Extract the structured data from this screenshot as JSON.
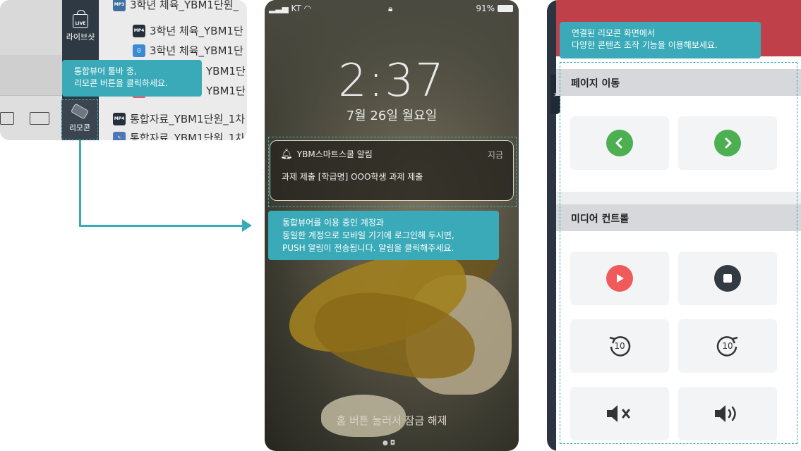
{
  "panel_viewer": {
    "live_label": "라이브샷",
    "live_badge": "LIVE",
    "remote_label": "리모콘",
    "files": [
      {
        "type": "MP3",
        "name": "3학년 체육_YBM1단원_"
      },
      {
        "type": "MP4",
        "name": "3학년 체육_YBM1단"
      },
      {
        "type": "",
        "name": "3학년 체육_YBM1단"
      },
      {
        "type": "",
        "name": "YBM1단"
      },
      {
        "type": "",
        "name": "YBM1단"
      },
      {
        "type": "MP4",
        "name": "통합자료_YBM1단원_1차"
      },
      {
        "type": "",
        "name": "통합자료_YBM1단원_1차"
      }
    ],
    "tooltip_line1": "통합뷰어 툴바 중,",
    "tooltip_line2": "리모콘 버튼을 클릭하세요."
  },
  "panel_phone": {
    "status_carrier": "KT",
    "status_battery": "91%",
    "clock": "2:37",
    "date": "7월 26일 월요일",
    "notification": {
      "app": "YBM스마트스쿨 알림",
      "time": "지금",
      "message": "과제 제출 [학급명] OOO학생 과제 제출"
    },
    "tooltip_line1": "통합뷰어를 이용 중인 계정과",
    "tooltip_line2": "동일한 계정으로 모바일 기기에 로그인해 두시면,",
    "tooltip_line3": "PUSH 알림이 전송됩니다. 알림을 클릭해주세요.",
    "unlock_text": "홈 버튼 눌러서 잠금 해제"
  },
  "panel_remote": {
    "tooltip_line1": "연결된 리모콘 화면에서",
    "tooltip_line2": "다양한 콘텐츠 조작 기능을 이용해보세요.",
    "section_page": "페이지 이동",
    "section_media": "미디어 컨트롤",
    "rewind_label": "10",
    "forward_label": "10",
    "colors": {
      "accent": "#3aaab8",
      "prev_next": "#4caf50",
      "play": "#f05a5a",
      "stop": "#333a41"
    }
  }
}
